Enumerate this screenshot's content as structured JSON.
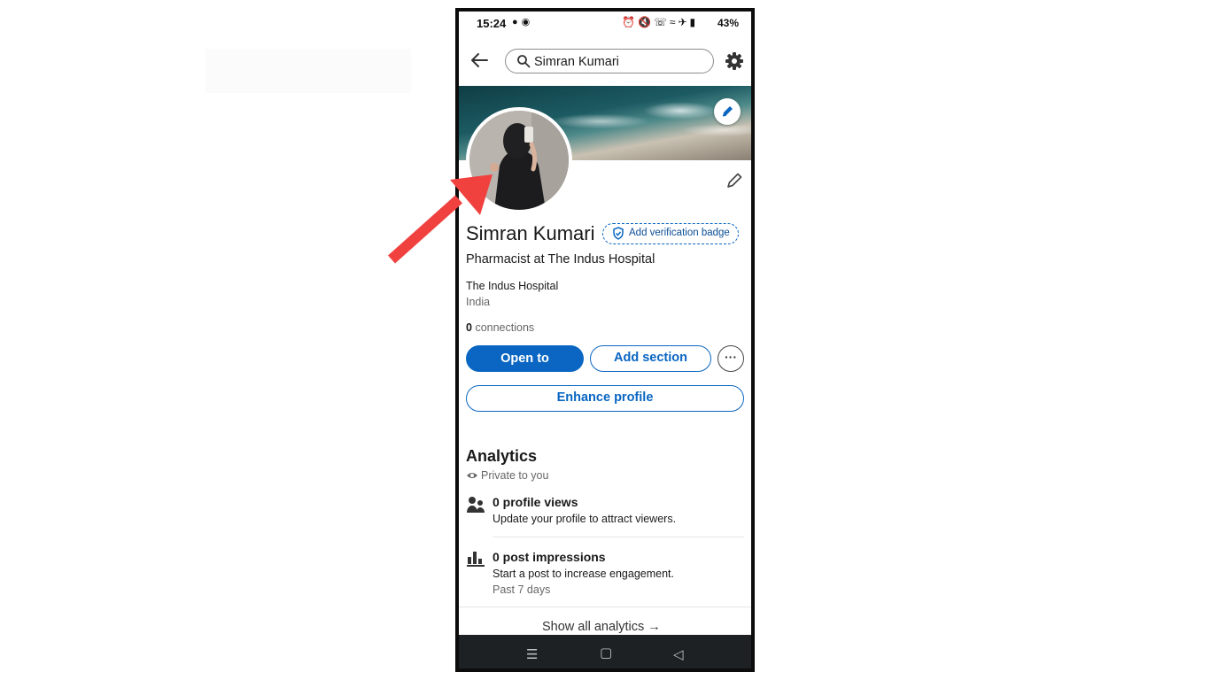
{
  "status_bar": {
    "time": "15:24",
    "battery": "43%"
  },
  "search": {
    "query": "Simran Kumari"
  },
  "profile": {
    "name": "Simran Kumari",
    "verification_badge_label": "Add verification badge",
    "headline": "Pharmacist at The Indus Hospital",
    "company": "The Indus Hospital",
    "location": "India",
    "connections_count": "0",
    "connections_label": "connections"
  },
  "actions": {
    "open_to": "Open to",
    "add_section": "Add section",
    "more": "···",
    "enhance_profile": "Enhance profile"
  },
  "analytics": {
    "title": "Analytics",
    "privacy": "Private to you",
    "items": [
      {
        "title": "0 profile views",
        "subtitle": "Update your profile to attract viewers.",
        "icon": "people-icon"
      },
      {
        "title": "0 post impressions",
        "subtitle": "Start a post to increase engagement.",
        "meta": "Past 7 days",
        "icon": "bar-chart-icon"
      }
    ],
    "show_all": "Show all analytics"
  },
  "colors": {
    "brand_blue": "#0a66c2",
    "annotation_red": "#f0413f",
    "nav_bar": "#1e2124"
  }
}
